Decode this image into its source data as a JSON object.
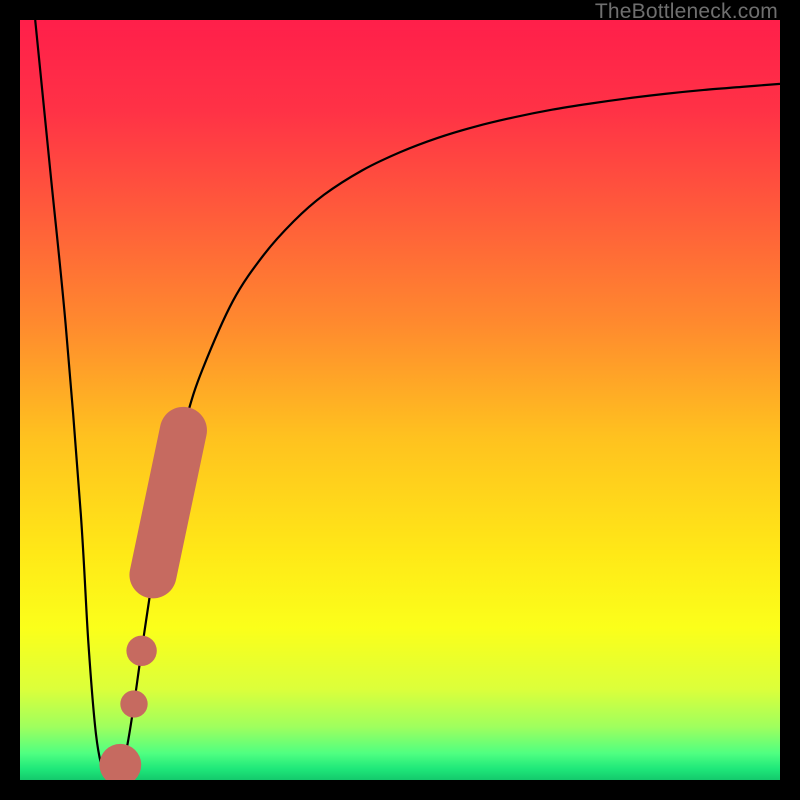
{
  "watermark": "TheBottleneck.com",
  "colors": {
    "marker": "#c66a60",
    "curve": "#000000",
    "frame": "#000000"
  },
  "chart_data": {
    "type": "line",
    "title": "",
    "xlabel": "",
    "ylabel": "",
    "xlim": [
      0,
      100
    ],
    "ylim": [
      0,
      100
    ],
    "grid": false,
    "series": [
      {
        "name": "bottleneck-curve",
        "x": [
          2,
          4,
          6,
          8,
          9,
          10,
          11,
          12,
          13,
          14,
          15,
          16,
          18,
          20,
          22,
          24,
          28,
          32,
          36,
          40,
          45,
          50,
          55,
          60,
          65,
          70,
          75,
          80,
          85,
          90,
          95,
          100
        ],
        "y": [
          100,
          80,
          60,
          35,
          18,
          6,
          1,
          0.5,
          1,
          4,
          10,
          17,
          30,
          40,
          48,
          54,
          63,
          69,
          73.5,
          77,
          80.2,
          82.6,
          84.5,
          86,
          87.2,
          88.2,
          89,
          89.7,
          90.3,
          90.8,
          91.2,
          91.6
        ]
      }
    ],
    "markers": [
      {
        "name": "thick-segment",
        "x_range": [
          17.5,
          21.5
        ],
        "y_range": [
          27,
          46
        ],
        "width": 6.2
      },
      {
        "name": "dot-1",
        "x": 16.0,
        "y": 17,
        "r": 4.0
      },
      {
        "name": "dot-2",
        "x": 15.0,
        "y": 10,
        "r": 3.6
      },
      {
        "name": "dot-3",
        "x": 13.2,
        "y": 2.0,
        "r": 5.5
      }
    ],
    "gradient_stops": [
      {
        "offset": 0.0,
        "color": "#ff1f4a"
      },
      {
        "offset": 0.12,
        "color": "#ff3246"
      },
      {
        "offset": 0.25,
        "color": "#ff5a3b"
      },
      {
        "offset": 0.4,
        "color": "#ff8a2e"
      },
      {
        "offset": 0.55,
        "color": "#ffc21f"
      },
      {
        "offset": 0.7,
        "color": "#ffe817"
      },
      {
        "offset": 0.8,
        "color": "#fbff1a"
      },
      {
        "offset": 0.88,
        "color": "#dcff3a"
      },
      {
        "offset": 0.93,
        "color": "#9fff5e"
      },
      {
        "offset": 0.965,
        "color": "#4fff81"
      },
      {
        "offset": 0.985,
        "color": "#1fe87a"
      },
      {
        "offset": 1.0,
        "color": "#14c96c"
      }
    ]
  }
}
